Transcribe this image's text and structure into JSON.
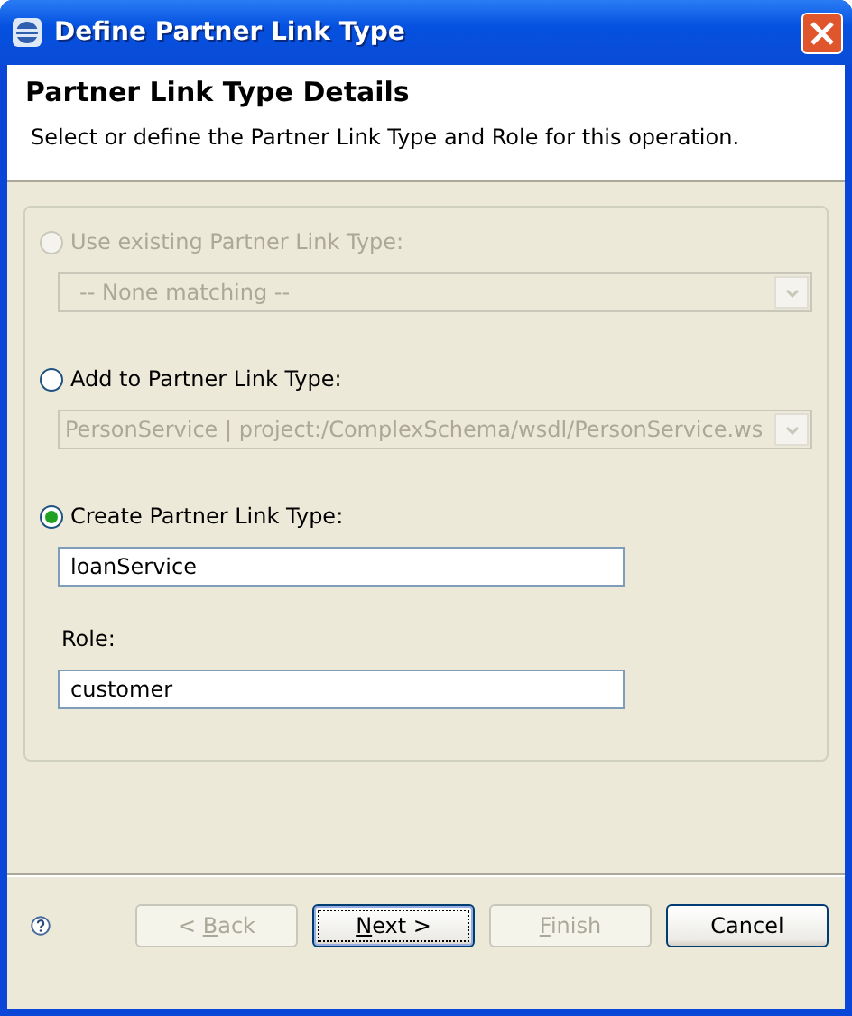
{
  "window": {
    "title": "Define Partner Link Type"
  },
  "header": {
    "title": "Partner Link Type Details",
    "description": "Select or define the Partner Link Type and Role for this operation."
  },
  "options": [
    {
      "label": "Use existing Partner Link Type:",
      "selected": false,
      "disabled": true,
      "kind": "combo",
      "value": "-- None matching --",
      "field_disabled": true
    },
    {
      "label": "Add to Partner Link Type:",
      "selected": false,
      "disabled": false,
      "kind": "combo",
      "value": "PersonService | project:/ComplexSchema/wsdl/PersonService.ws",
      "field_disabled": true
    },
    {
      "label": "Create Partner Link Type:",
      "selected": true,
      "disabled": false,
      "kind": "text",
      "value": "loanService",
      "field_disabled": false
    }
  ],
  "role": {
    "label": "Role:",
    "value": "customer"
  },
  "buttons": [
    {
      "before": "< ",
      "key": "B",
      "after": "ack",
      "disabled": true,
      "default": false
    },
    {
      "key": "N",
      "after": "ext >",
      "disabled": false,
      "default": true
    },
    {
      "key": "F",
      "after": "inish",
      "disabled": true,
      "default": false
    },
    {
      "before": "Cancel",
      "disabled": false,
      "default": false
    }
  ]
}
